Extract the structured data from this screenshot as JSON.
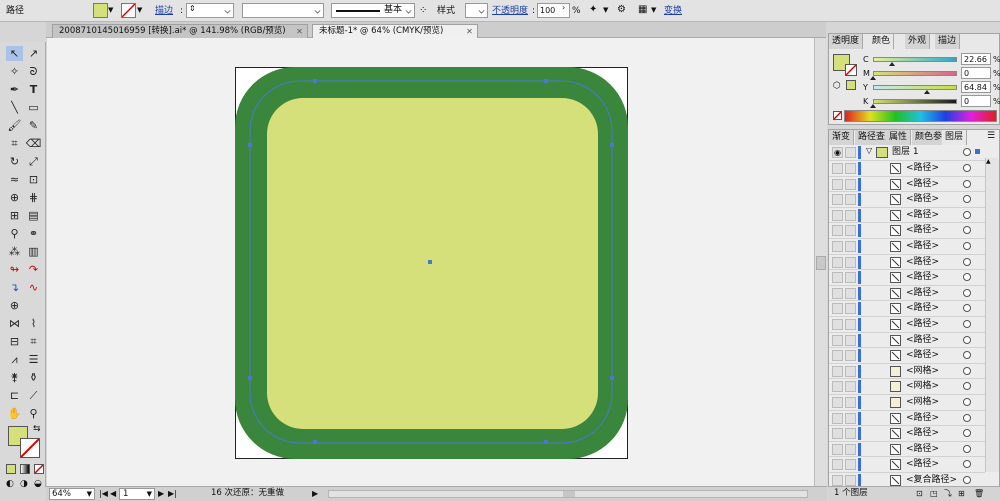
{
  "control_bar": {
    "selection_label": "路径",
    "fill_color": "#d5e07a",
    "stroke_label": "描边",
    "stroke_style_label": "基本",
    "style_label": "样式",
    "opacity_label": "不透明度",
    "opacity_value": "100",
    "opacity_unit": "%",
    "transform_label": "变换"
  },
  "tabs": [
    {
      "label": "2008710145016959 [转换].ai* @ 141.98% (RGB/预览)"
    },
    {
      "label": "未标题-1* @ 64% (CMYK/预览)"
    }
  ],
  "artwork": {
    "outer_color": "#3a863c",
    "inner_color": "#d5e07a",
    "path_color": "#4a78d0",
    "page_color": "#ffffff"
  },
  "status_bar": {
    "zoom": "64%",
    "artboard": "1",
    "undo_text": "16 次还原：无重做"
  },
  "color_panel": {
    "tabs": [
      "透明度",
      "颜色",
      "外观",
      "描边"
    ],
    "active_tab": "颜色",
    "sliders": [
      {
        "label": "C",
        "value": "22.66",
        "unit": "%",
        "level": 22.66
      },
      {
        "label": "M",
        "value": "0",
        "unit": "%",
        "level": 0
      },
      {
        "label": "Y",
        "value": "64.84",
        "unit": "%",
        "level": 64.84
      },
      {
        "label": "K",
        "value": "0",
        "unit": "%",
        "level": 0
      }
    ]
  },
  "layers_panel": {
    "tabs": [
      "渐变",
      "路径查",
      "属性",
      "颜色参",
      "图层"
    ],
    "active_tab": "图层",
    "top_layer": "图层 1",
    "items": [
      "<路径>",
      "<路径>",
      "<路径>",
      "<路径>",
      "<路径>",
      "<路径>",
      "<路径>",
      "<路径>",
      "<路径>",
      "<路径>",
      "<路径>",
      "<路径>",
      "<路径>",
      "<网格>",
      "<网格>",
      "<网格>",
      "<路径>",
      "<路径>",
      "<路径>",
      "<路径>",
      "<复合路径>"
    ],
    "footer": "1 个图层"
  }
}
